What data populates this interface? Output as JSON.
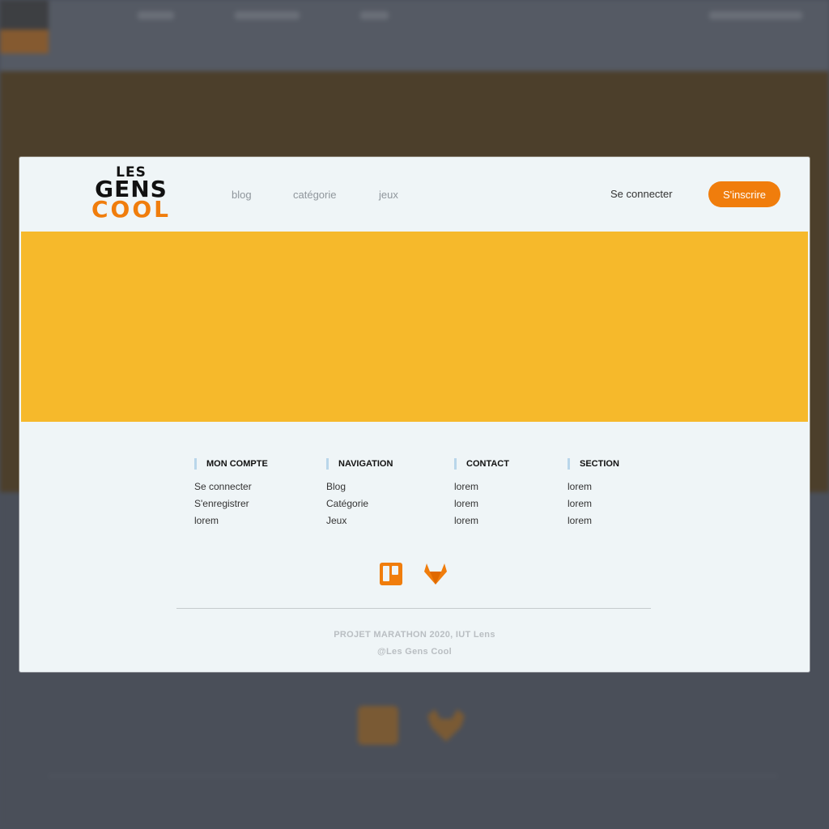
{
  "logo": {
    "line1": "LES",
    "line2": "GENS",
    "line3": "COOL"
  },
  "nav": {
    "items": [
      "blog",
      "catégorie",
      "jeux"
    ]
  },
  "auth": {
    "login": "Se connecter",
    "signup": "S'inscrire"
  },
  "footer": {
    "columns": [
      {
        "title": "MON COMPTE",
        "links": [
          "Se connecter",
          "S'enregistrer",
          "lorem"
        ]
      },
      {
        "title": "NAVIGATION",
        "links": [
          "Blog",
          "Catégorie",
          "Jeux"
        ]
      },
      {
        "title": "CONTACT",
        "links": [
          "lorem",
          "lorem",
          "lorem"
        ]
      },
      {
        "title": "SECTION",
        "links": [
          "lorem",
          "lorem",
          "lorem"
        ]
      }
    ],
    "social": [
      "trello-icon",
      "gitlab-icon"
    ],
    "copyright_line1": "PROJET MARATHON 2020, IUT Lens",
    "copyright_line2": "@Les Gens Cool"
  },
  "colors": {
    "accent": "#f07d0c",
    "hero": "#f6b92b",
    "page_bg": "#eff5f7",
    "overlay": "#4a4f5a"
  }
}
